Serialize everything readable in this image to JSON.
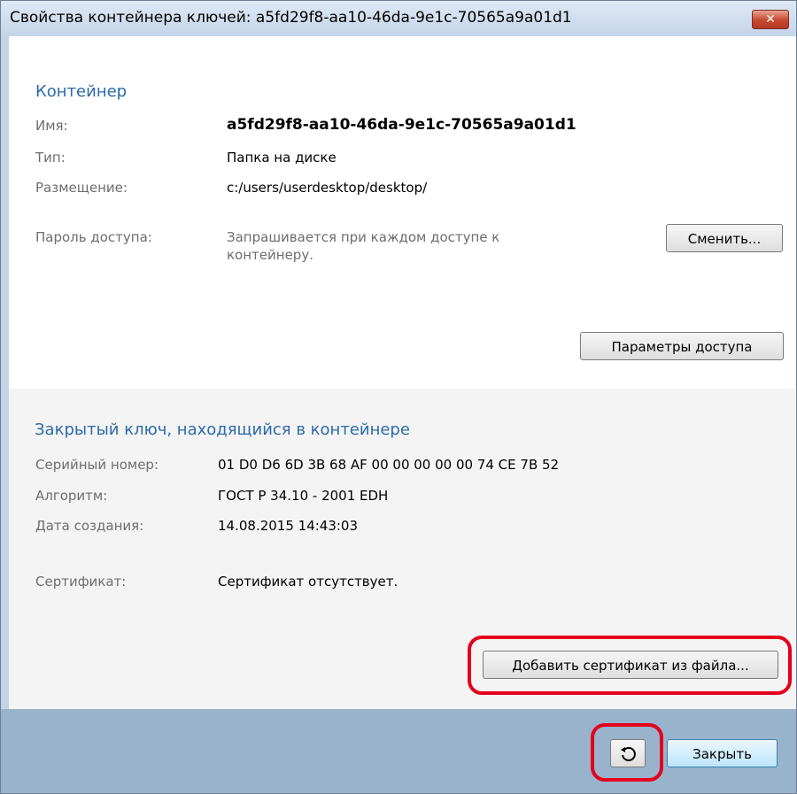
{
  "window": {
    "title": "Свойства контейнера ключей: a5fd29f8-aa10-46da-9e1c-70565a9a01d1",
    "close_glyph": "✕"
  },
  "container": {
    "heading": "Контейнер",
    "name_label": "Имя:",
    "name_value": "a5fd29f8-aa10-46da-9e1c-70565a9a01d1",
    "type_label": "Тип:",
    "type_value": "Папка на диске",
    "location_label": "Размещение:",
    "location_value": "c:/users/userdesktop/desktop/",
    "password_label": "Пароль доступа:",
    "password_value": "Запрашивается при каждом доступе к контейнеру.",
    "change_button": "Сменить...",
    "access_params_button": "Параметры доступа"
  },
  "private_key": {
    "heading": "Закрытый ключ, находящийся в контейнере",
    "serial_label": "Серийный номер:",
    "serial_value": "01 D0 D6 6D 3B 68 AF 00 00 00 00 00 74 CE 7B 52",
    "algorithm_label": "Алгоритм:",
    "algorithm_value": "ГОСТ Р 34.10 - 2001 EDH",
    "created_label": "Дата создания:",
    "created_value": "14.08.2015 14:43:03",
    "certificate_label": "Сертификат:",
    "certificate_value": "Сертификат отсутствует.",
    "add_cert_button": "Добавить сертификат из файла..."
  },
  "footer": {
    "refresh_icon": "refresh-icon",
    "close_button": "Закрыть"
  },
  "colors": {
    "heading": "#2d6aaa",
    "highlight": "#e3001b",
    "footer": "#99b3cd"
  }
}
